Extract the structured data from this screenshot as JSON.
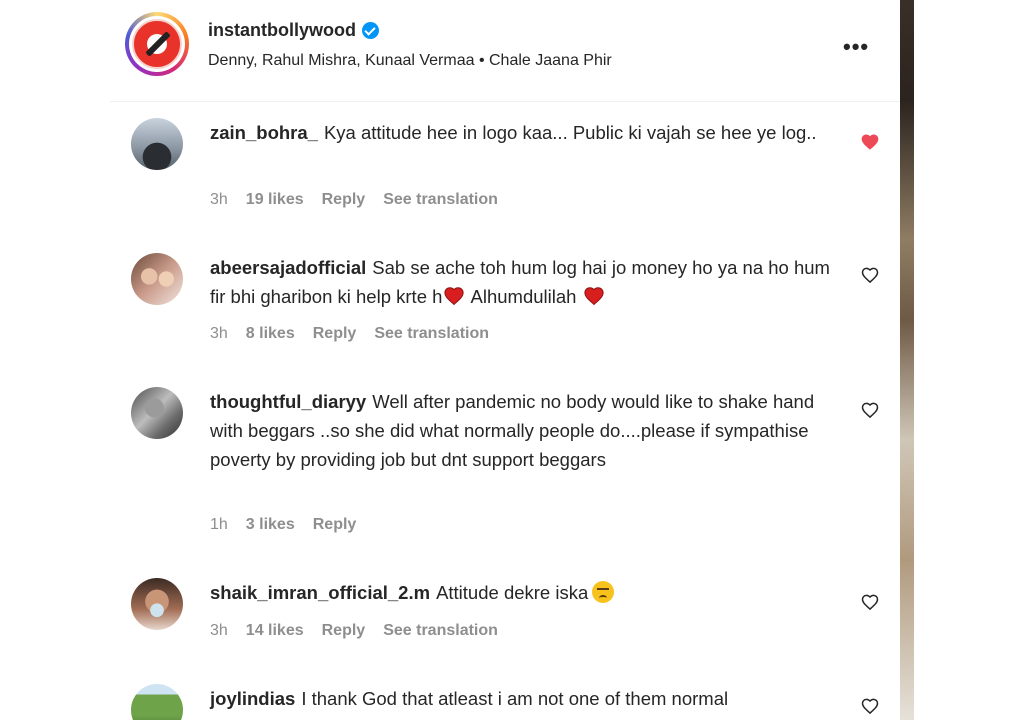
{
  "header": {
    "username": "instantbollywood",
    "audio": "Denny, Rahul Mishra, Kunaal Vermaa • Chale Jaana Phir",
    "more_label": "•••"
  },
  "comments": [
    {
      "username": "zain_bohra_",
      "text_parts": [
        "Kya attitude hee in logo kaa... Public ki vajah se hee ye log.."
      ],
      "time": "3h",
      "likes": "19 likes",
      "reply": "Reply",
      "translate": "See translation",
      "liked": true
    },
    {
      "username": "abeersajadofficial",
      "text_parts": [
        "Sab se ache toh hum log hai jo money ho ya na ho hum fir bhi gharibon ki help krte h",
        " Alhumdulilah "
      ],
      "time": "3h",
      "likes": "8 likes",
      "reply": "Reply",
      "translate": "See translation",
      "liked": false
    },
    {
      "username": "thoughtful_diaryy",
      "text_parts": [
        "Well after pandemic no body would like to shake hand with beggars ..so she did what normally people do....please if sympathise poverty by providing job but dnt support beggars"
      ],
      "time": "1h",
      "likes": "3 likes",
      "reply": "Reply",
      "liked": false
    },
    {
      "username": "shaik_imran_official_2.m",
      "text_parts": [
        "Attitude dekre iska"
      ],
      "time": "3h",
      "likes": "14 likes",
      "reply": "Reply",
      "translate": "See translation",
      "liked": false
    },
    {
      "username": "joylindias",
      "text_parts": [
        "I thank God that atleast i am not one of them normal"
      ],
      "liked": false
    }
  ],
  "colors": {
    "like_red": "#ed4956",
    "meta_gray": "#8e8e8e",
    "verified_blue": "#0095f6"
  },
  "icons": {
    "liked": "heart-filled-icon",
    "unliked": "heart-outline-icon",
    "verified": "verified-badge-icon",
    "more": "more-options-icon"
  }
}
